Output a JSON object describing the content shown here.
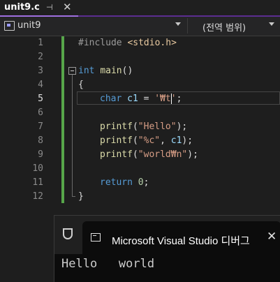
{
  "tab": {
    "title": "unit9.c",
    "pin_glyph": "⊣",
    "close_glyph": "✕"
  },
  "navbar": {
    "scope": "unit9",
    "global_scope": "(전역 범위)"
  },
  "editor": {
    "line_numbers": [
      "1",
      "2",
      "3",
      "4",
      "5",
      "6",
      "7",
      "8",
      "9",
      "10",
      "11",
      "12"
    ],
    "active_line": 5,
    "code": {
      "l1": {
        "directive": "#include",
        "header": "<stdio.h>"
      },
      "l3": {
        "kw": "int",
        "fn": "main",
        "rest": "()"
      },
      "l4": {
        "text": "{"
      },
      "l5": {
        "kw": "char",
        "var": "c1",
        "op": " = ",
        "str_a": "'₩t",
        "str_b": "'",
        "end": ";"
      },
      "l7": {
        "fn": "printf",
        "open": "(",
        "str": "\"Hello\"",
        "close": ");"
      },
      "l8": {
        "fn": "printf",
        "open": "(",
        "str": "\"%c\"",
        "mid": ", ",
        "var": "c1",
        "close": ");"
      },
      "l9": {
        "fn": "printf",
        "open": "(",
        "str": "\"world₩n\"",
        "close": ");"
      },
      "l11": {
        "kw": "return",
        "num": "0",
        "end": ";"
      },
      "l12": {
        "text": "}"
      }
    }
  },
  "console": {
    "title": "Microsoft Visual Studio 디버그",
    "close_glyph": "✕",
    "output": "Hello   world"
  },
  "colors": {
    "editor_bg": "#1e1e1e",
    "keyword": "#569cd6",
    "function": "#dcdcaa",
    "string": "#d69d85",
    "number": "#b5cea8",
    "variable": "#9cdcfe",
    "change_bar": "#57a64a",
    "tab_accent": "#9f6fe0"
  },
  "icons": [
    "pin-icon",
    "close-icon",
    "scope-icon",
    "dropdown-arrow-icon",
    "fold-collapse-icon",
    "shield-icon",
    "terminal-icon"
  ]
}
